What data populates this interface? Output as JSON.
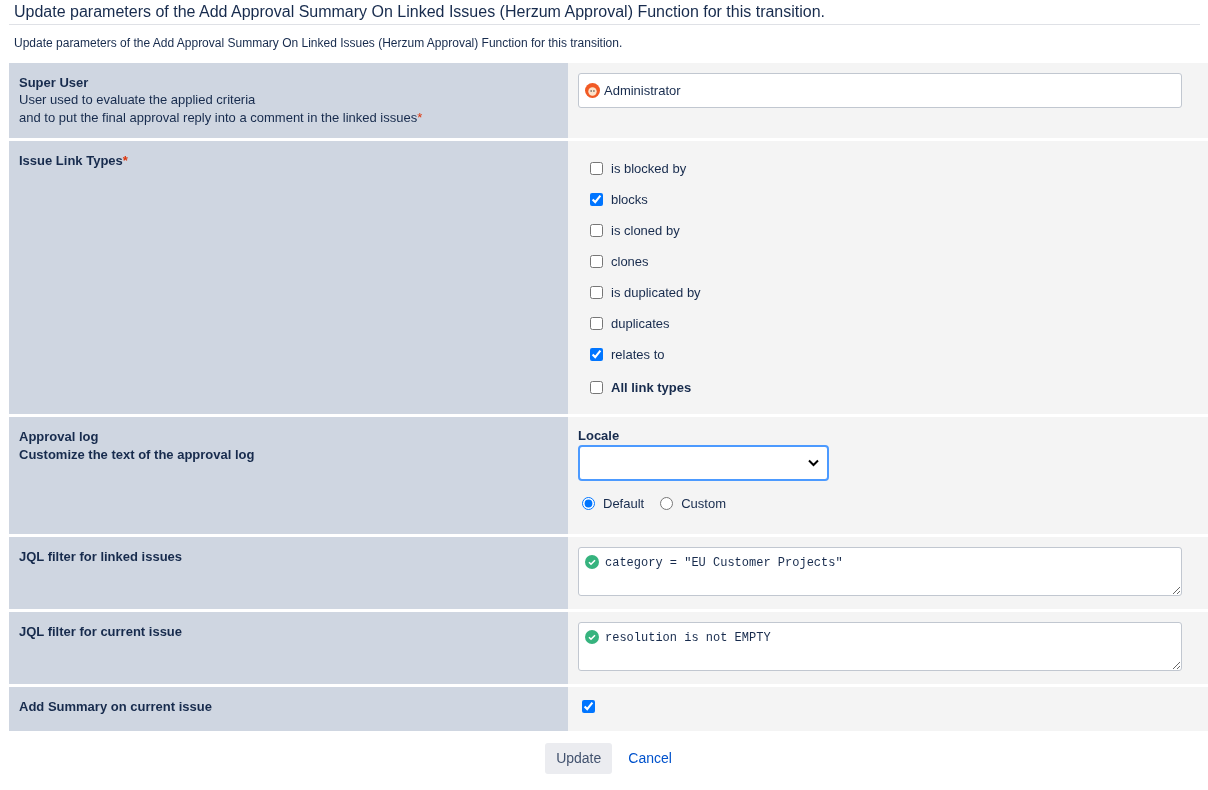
{
  "heading": "Update parameters of the Add Approval Summary On Linked Issues (Herzum Approval) Function for this transition.",
  "intro": "Update parameters of the Add Approval Summary On Linked Issues (Herzum Approval) Function for this transition.",
  "fields": [
    {
      "kind": "user",
      "label": "Super User",
      "description": [
        "User used to evaluate the applied criteria",
        "and to put the final approval reply into a comment in the linked issues"
      ],
      "required_mark": "*",
      "value": "Administrator"
    },
    {
      "kind": "checkboxes",
      "label": "Issue Link Types",
      "required_mark": "*",
      "options": [
        {
          "label": "is blocked by",
          "checked": false,
          "bold": false
        },
        {
          "label": "blocks",
          "checked": true,
          "bold": false
        },
        {
          "label": "is cloned by",
          "checked": false,
          "bold": false
        },
        {
          "label": "clones",
          "checked": false,
          "bold": false
        },
        {
          "label": "is duplicated by",
          "checked": false,
          "bold": false
        },
        {
          "label": "duplicates",
          "checked": false,
          "bold": false
        },
        {
          "label": "relates to",
          "checked": true,
          "bold": false
        },
        {
          "label": "All link types",
          "checked": false,
          "bold": true
        }
      ]
    },
    {
      "kind": "approval_log",
      "label": "Approval log",
      "subtitle": "Customize the text of the approval log",
      "select_label": "Locale",
      "radios": [
        {
          "label": "Default",
          "selected": true
        },
        {
          "label": "Custom",
          "selected": false
        }
      ]
    },
    {
      "kind": "jql",
      "label": "JQL filter for linked issues",
      "value": "category = \"EU Customer Projects\"",
      "valid": true
    },
    {
      "kind": "jql",
      "label": "JQL filter for current issue",
      "value": "resolution is not EMPTY",
      "valid": true
    },
    {
      "kind": "checkbox",
      "label": "Add Summary on current issue",
      "checked": true
    }
  ],
  "buttons": {
    "submit": "Update",
    "cancel": "Cancel"
  }
}
